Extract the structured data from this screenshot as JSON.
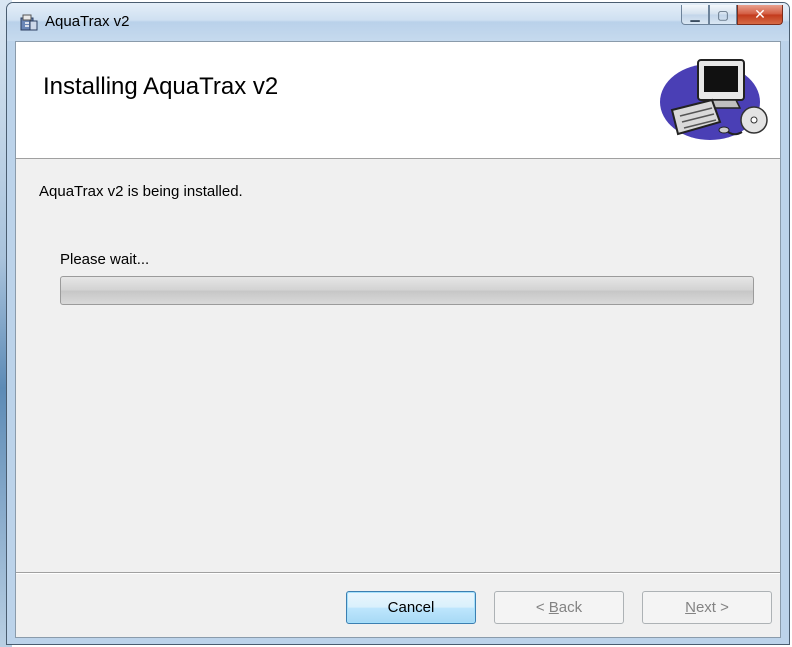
{
  "window": {
    "title": "AquaTrax v2"
  },
  "banner": {
    "title": "Installing AquaTrax v2"
  },
  "body": {
    "status_text": "AquaTrax v2 is being installed.",
    "wait_label": "Please wait...",
    "progress_percent": 0
  },
  "buttons": {
    "cancel": "Cancel",
    "back_prefix": "< ",
    "back_accel": "B",
    "back_rest": "ack",
    "next_accel": "N",
    "next_rest": "ext >"
  },
  "icons": {
    "title": "installer-icon",
    "banner": "computer-install-art"
  },
  "colors": {
    "progress_track": "#d2d2d2",
    "close_button": "#c2391b",
    "default_button_border": "#3c7fb1"
  }
}
